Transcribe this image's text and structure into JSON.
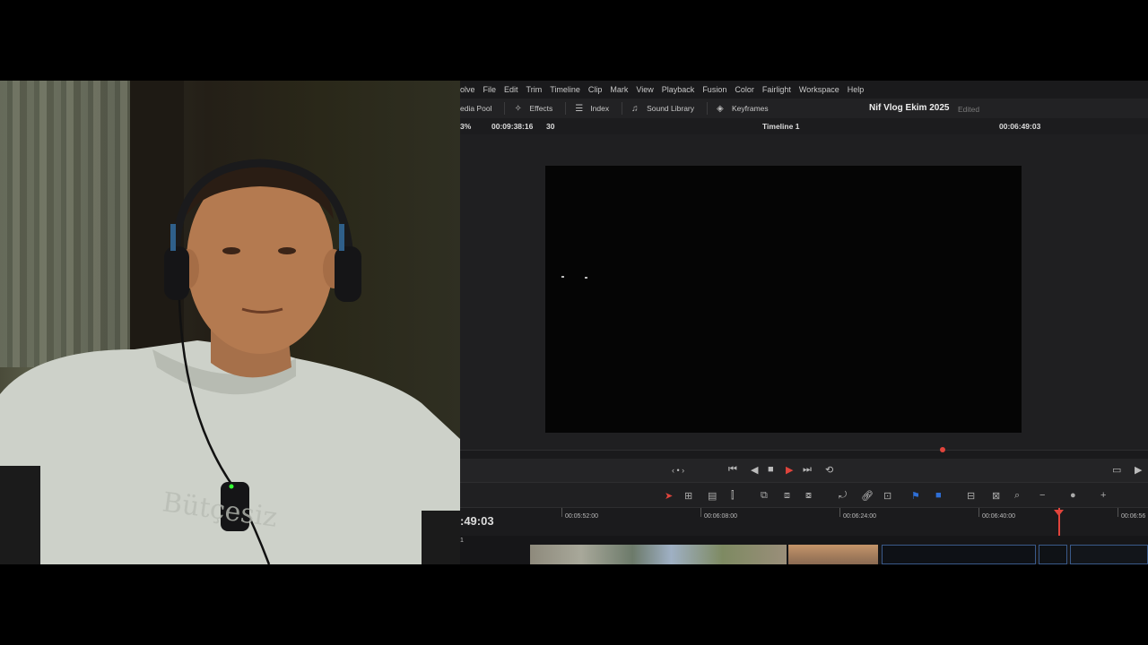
{
  "menu": [
    "olve",
    "File",
    "Edit",
    "Trim",
    "Timeline",
    "Clip",
    "Mark",
    "View",
    "Playback",
    "Fusion",
    "Color",
    "Fairlight",
    "Workspace",
    "Help"
  ],
  "toolbar": {
    "media_pool": "edia Pool",
    "effects": "Effects",
    "index": "Index",
    "sound_library": "Sound Library",
    "keyframes": "Keyframes"
  },
  "project": {
    "title": "Nif Vlog Ekim 2025",
    "status": "Edited"
  },
  "infobar": {
    "zoom": "3%",
    "source_timecode": "00:09:38:16",
    "fps": "30",
    "timeline_name": "Timeline 1",
    "record_timecode": "00:06:49:03"
  },
  "timeline": {
    "current_timecode": ":49:03",
    "ruler_labels": [
      "00:05:52:00",
      "00:06:08:00",
      "00:06:24:00",
      "00:06:40:00",
      "00:06:56"
    ],
    "track_label": "1"
  },
  "colors": {
    "accent_red": "#e0443c",
    "link_blue": "#2f6fd6",
    "panel_bg": "#1f1f21"
  }
}
